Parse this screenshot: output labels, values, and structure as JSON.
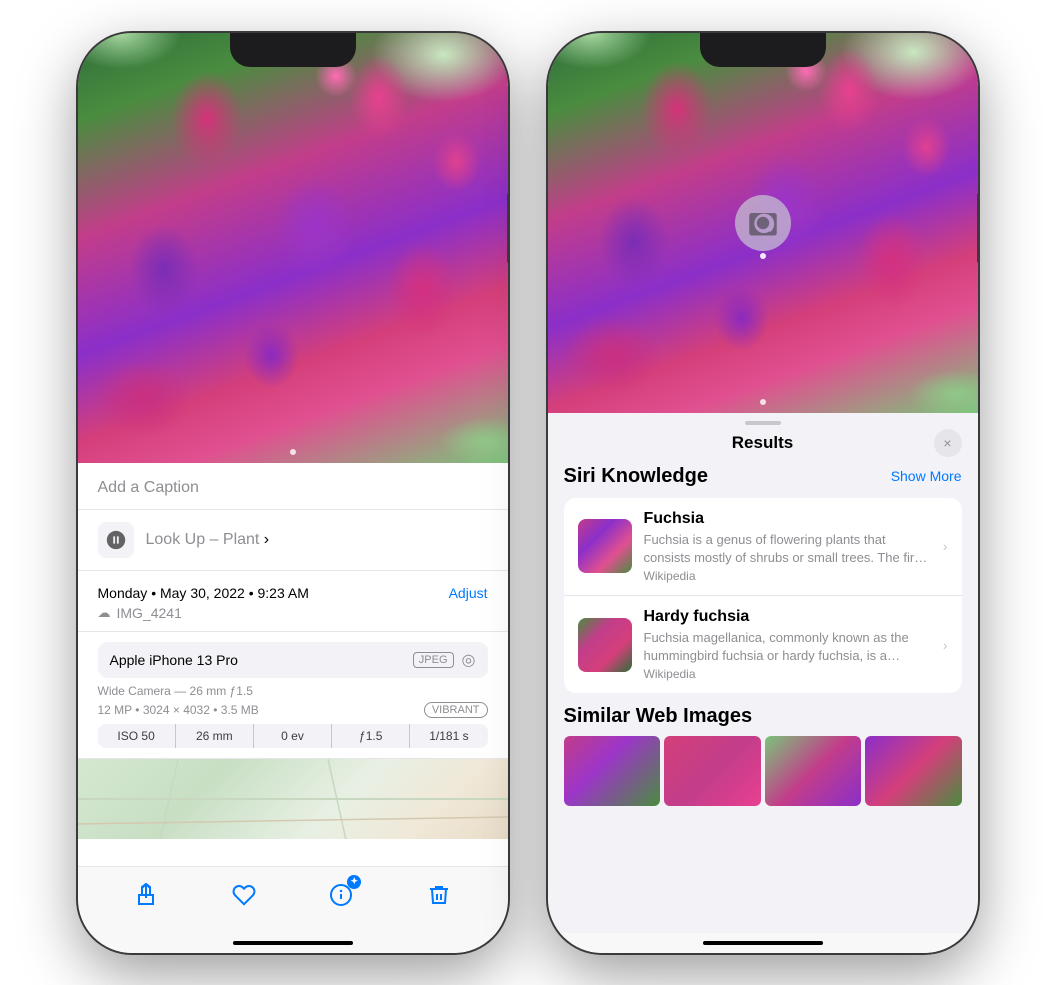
{
  "phone1": {
    "caption_placeholder": "Add a Caption",
    "lookup_label": "Look Up –",
    "lookup_subject": "Plant",
    "date": "Monday • May 30, 2022 • 9:23 AM",
    "adjust_label": "Adjust",
    "filename": "IMG_4241",
    "device_name": "Apple iPhone 13 Pro",
    "format_badge": "JPEG",
    "camera_details": "Wide Camera — 26 mm ƒ1.5",
    "mp_info": "12 MP • 3024 × 4032 • 3.5 MB",
    "vibrant_label": "VIBRANT",
    "exif": {
      "iso": "ISO 50",
      "focal": "26 mm",
      "ev": "0 ev",
      "aperture": "ƒ1.5",
      "shutter": "1/181 s"
    },
    "toolbar": {
      "share": "⬆",
      "heart": "♡",
      "info": "✦ⓘ",
      "trash": "🗑"
    }
  },
  "phone2": {
    "results_title": "Results",
    "close_label": "×",
    "siri_knowledge_title": "Siri Knowledge",
    "show_more_label": "Show More",
    "items": [
      {
        "name": "Fuchsia",
        "description": "Fuchsia is a genus of flowering plants that consists mostly of shrubs or small trees. The first to be scientific...",
        "source": "Wikipedia"
      },
      {
        "name": "Hardy fuchsia",
        "description": "Fuchsia magellanica, commonly known as the hummingbird fuchsia or hardy fuchsia, is a species of floweri...",
        "source": "Wikipedia"
      }
    ],
    "similar_title": "Similar Web Images"
  }
}
